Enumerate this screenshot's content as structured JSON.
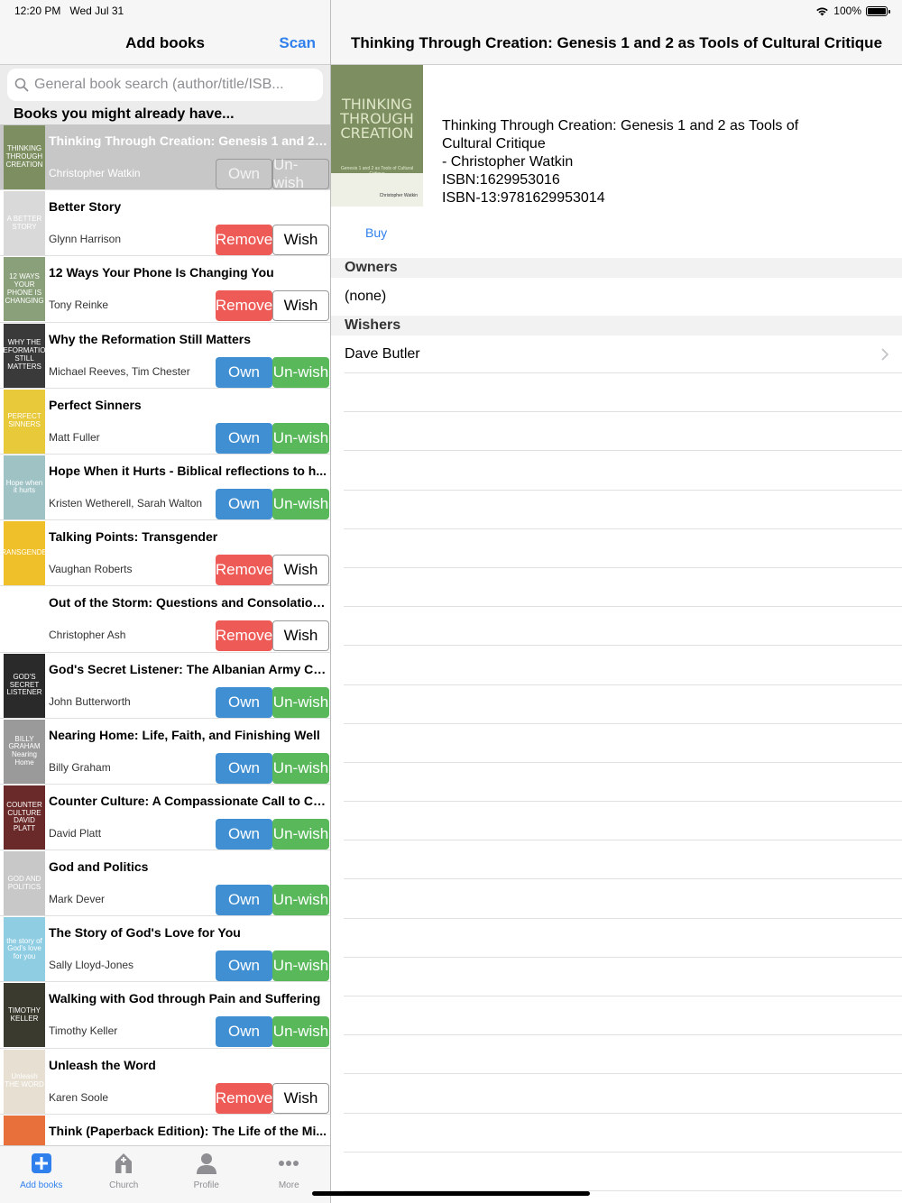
{
  "status": {
    "time": "12:20 PM",
    "date": "Wed Jul 31",
    "battery": "100%"
  },
  "left": {
    "title": "Add books",
    "scan_label": "Scan",
    "search_placeholder": "General book search (author/title/ISB...",
    "section_header": "Books you might already have...",
    "books": [
      {
        "title": "Thinking Through Creation: Genesis 1 and 2 a...",
        "author": "Christopher Watkin",
        "btn1": "Own",
        "btn2": "Un-wish",
        "state": "selected",
        "cover_text": "THINKING THROUGH CREATION",
        "cover_color": "#7d8e60"
      },
      {
        "title": "Better Story",
        "author": "Glynn Harrison",
        "btn1": "Remove",
        "btn2": "Wish",
        "state": "owned",
        "cover_text": "A BETTER STORY",
        "cover_color": "#d9d9d9"
      },
      {
        "title": "12 Ways Your Phone Is Changing You",
        "author": "Tony Reinke",
        "btn1": "Remove",
        "btn2": "Wish",
        "state": "owned",
        "cover_text": "12 WAYS YOUR PHONE IS CHANGING",
        "cover_color": "#8aa07a"
      },
      {
        "title": "Why the Reformation Still Matters",
        "author": "Michael Reeves, Tim Chester",
        "btn1": "Own",
        "btn2": "Un-wish",
        "state": "wished",
        "cover_text": "WHY THE REFORMATION STILL MATTERS",
        "cover_color": "#3a3a3a"
      },
      {
        "title": "Perfect Sinners",
        "author": "Matt Fuller",
        "btn1": "Own",
        "btn2": "Un-wish",
        "state": "wished",
        "cover_text": "PERFECT SINNERS",
        "cover_color": "#e8c93a"
      },
      {
        "title": "Hope When it Hurts - Biblical reflections to h...",
        "author": "Kristen Wetherell, Sarah Walton",
        "btn1": "Own",
        "btn2": "Un-wish",
        "state": "wished",
        "cover_text": "Hope when it hurts",
        "cover_color": "#9fc2c5"
      },
      {
        "title": "Talking Points: Transgender",
        "author": "Vaughan Roberts",
        "btn1": "Remove",
        "btn2": "Wish",
        "state": "owned",
        "cover_text": "TRANSGENDER",
        "cover_color": "#efc02a"
      },
      {
        "title": "Out of the Storm: Questions and Consolation...",
        "author": "Christopher Ash",
        "btn1": "Remove",
        "btn2": "Wish",
        "state": "owned",
        "cover_text": "",
        "cover_color": "#ffffff"
      },
      {
        "title": "God's Secret Listener: The Albanian Army Ca...",
        "author": "John Butterworth",
        "btn1": "Own",
        "btn2": "Un-wish",
        "state": "wished",
        "cover_text": "GOD'S SECRET LISTENER",
        "cover_color": "#2a2a2a"
      },
      {
        "title": "Nearing Home: Life, Faith, and Finishing Well",
        "author": "Billy Graham",
        "btn1": "Own",
        "btn2": "Un-wish",
        "state": "wished",
        "cover_text": "BILLY GRAHAM Nearing Home",
        "cover_color": "#9a9a9a"
      },
      {
        "title": "Counter Culture: A Compassionate Call to Co...",
        "author": "David Platt",
        "btn1": "Own",
        "btn2": "Un-wish",
        "state": "wished",
        "cover_text": "COUNTER CULTURE DAVID PLATT",
        "cover_color": "#6b2a2a"
      },
      {
        "title": "God and Politics",
        "author": "Mark Dever",
        "btn1": "Own",
        "btn2": "Un-wish",
        "state": "wished",
        "cover_text": "GOD AND POLITICS",
        "cover_color": "#c8c8c8"
      },
      {
        "title": "The Story of God's Love for You",
        "author": "Sally Lloyd-Jones",
        "btn1": "Own",
        "btn2": "Un-wish",
        "state": "wished",
        "cover_text": "the story of God's love for you",
        "cover_color": "#8fcde3"
      },
      {
        "title": "Walking with God through Pain and Suffering",
        "author": "Timothy Keller",
        "btn1": "Own",
        "btn2": "Un-wish",
        "state": "wished",
        "cover_text": "TIMOTHY KELLER",
        "cover_color": "#3a3a2e"
      },
      {
        "title": "Unleash the Word",
        "author": "Karen Soole",
        "btn1": "Remove",
        "btn2": "Wish",
        "state": "owned",
        "cover_text": "Unleash THE WORD",
        "cover_color": "#e7e0d2"
      },
      {
        "title": "Think (Paperback Edition): The Life of the Mi...",
        "author": "",
        "btn1": "",
        "btn2": "",
        "state": "partial",
        "cover_text": "",
        "cover_color": "#e8703a"
      }
    ],
    "tabs": [
      {
        "label": "Add books",
        "icon": "plus-icon",
        "active": true
      },
      {
        "label": "Church",
        "icon": "church-icon",
        "active": false
      },
      {
        "label": "Profile",
        "icon": "person-icon",
        "active": false
      },
      {
        "label": "More",
        "icon": "more-icon",
        "active": false
      }
    ]
  },
  "right": {
    "title": "Thinking Through Creation: Genesis 1 and 2 as Tools of Cultural Critique",
    "cover_text": "THINKING THROUGH CREATION",
    "cover_subtext": "Genesis 1 and 2 as Tools of Cultural Critique",
    "cover_author": "Christopher Watkin",
    "detail_title_line1": "Thinking Through Creation: Genesis 1 and 2 as Tools of",
    "detail_title_line2": "Cultural Critique",
    "detail_author": "- Christopher Watkin",
    "isbn": "ISBN:1629953016",
    "isbn13": "ISBN-13:9781629953014",
    "buy_label": "Buy",
    "owners_header": "Owners",
    "owners_value": "(none)",
    "wishers_header": "Wishers",
    "wishers": [
      "Dave Butler"
    ]
  }
}
